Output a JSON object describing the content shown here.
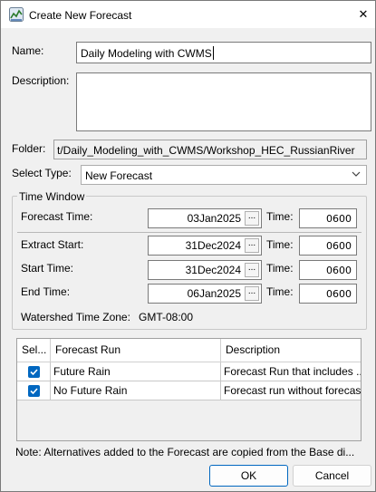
{
  "window": {
    "title": "Create New Forecast",
    "close_glyph": "✕"
  },
  "form": {
    "name_label": "Name:",
    "name_value": "Daily Modeling with CWMS",
    "description_label": "Description:",
    "description_value": "",
    "folder_label": "Folder:",
    "folder_value": "t/Daily_Modeling_with_CWMS/Workshop_HEC_RussianRiver",
    "select_type_label": "Select Type:",
    "select_type_value": "New Forecast"
  },
  "time_window": {
    "title": "Time Window",
    "time_label": "Time:",
    "picker_glyph": "...",
    "rows": [
      {
        "label": "Forecast Time:",
        "date": "03Jan2025",
        "time": "0600"
      },
      {
        "label": "Extract Start:",
        "date": "31Dec2024",
        "time": "0600"
      },
      {
        "label": "Start Time:",
        "date": "31Dec2024",
        "time": "0600"
      },
      {
        "label": "End Time:",
        "date": "06Jan2025",
        "time": "0600"
      }
    ],
    "timezone_label": "Watershed Time Zone:",
    "timezone_value": "GMT-08:00"
  },
  "runs_table": {
    "columns": [
      "Sel...",
      "Forecast Run",
      "Description"
    ],
    "rows": [
      {
        "selected": true,
        "run": "Future Rain",
        "description": "Forecast Run that includes ..."
      },
      {
        "selected": true,
        "run": "No Future Rain",
        "description": "Forecast run without forecast..."
      }
    ]
  },
  "note": "Note: Alternatives added to the Forecast are copied from the Base di...",
  "buttons": {
    "ok": "OK",
    "cancel": "Cancel"
  },
  "colors": {
    "accent": "#0067c0",
    "window_bg": "#f0f0f0"
  },
  "icons": {
    "app": "forecast-app-icon",
    "close": "close-icon",
    "dropdown": "chevron-down-icon",
    "check": "checkmark-icon"
  }
}
